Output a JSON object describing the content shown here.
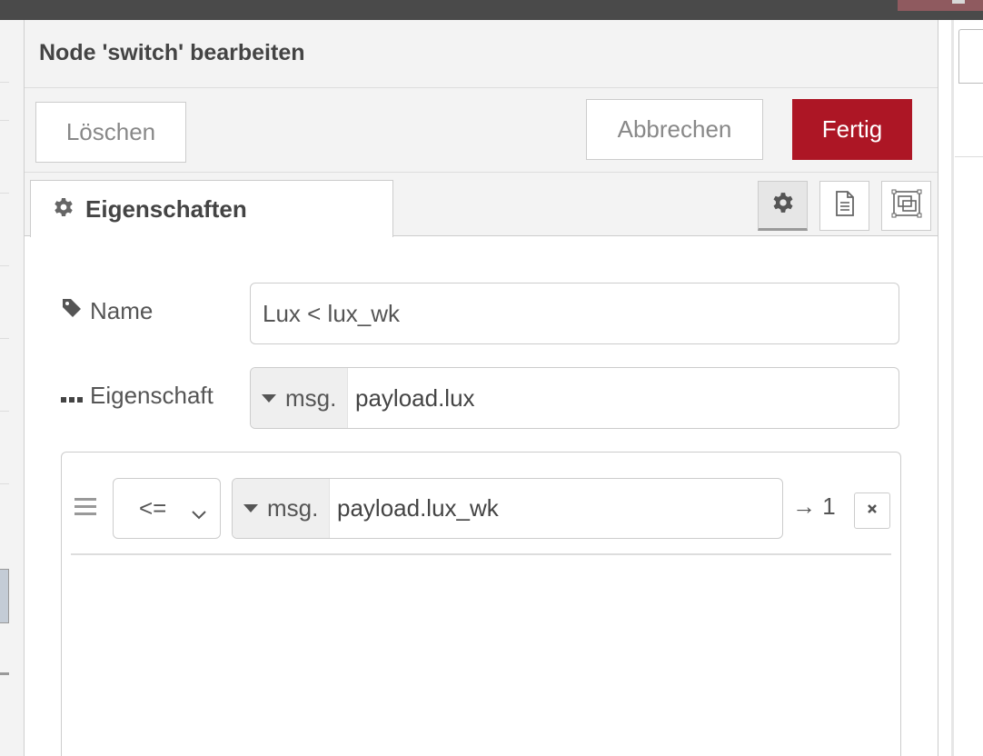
{
  "tray": {
    "title": "Node 'switch' bearbeiten",
    "delete_label": "Löschen",
    "cancel_label": "Abbrechen",
    "done_label": "Fertig"
  },
  "tabs": {
    "properties_label": "Eigenschaften",
    "icons": [
      "gear-icon",
      "description-icon",
      "appearance-icon"
    ]
  },
  "form": {
    "name_label": "Name",
    "name_value": "Lux < lux_wk",
    "property_label": "Eigenschaft",
    "property_type": "msg.",
    "property_value": "payload.lux"
  },
  "rules": [
    {
      "operator": "<=",
      "value_type": "msg.",
      "value": "payload.lux_wk",
      "output": "→ 1"
    }
  ],
  "colors": {
    "primary_button": "#ad1625",
    "topbar": "#4a4a4a"
  }
}
